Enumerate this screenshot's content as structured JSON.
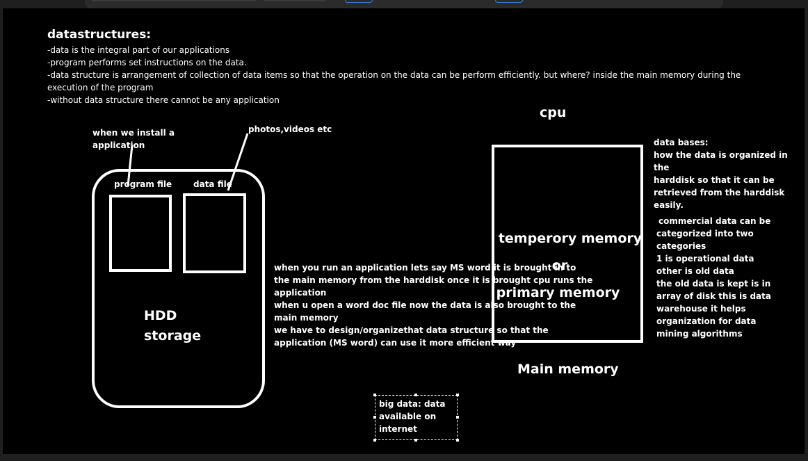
{
  "notes": {
    "heading": "datastructures:",
    "lines": [
      "-data is the integral part of our applications",
      "-program performs set instructions on the data.",
      "-data structure is arrangement of collection of data items so that the operation on the data can be perform efficiently. but where? inside the main memory during the",
      "execution of the program",
      "-without data structure there cannot be any application"
    ]
  },
  "hdd": {
    "install_note_1": "when we install a",
    "install_note_2": "application",
    "media_note": "photos,videos etc",
    "program_file": "program file",
    "data_file": "data file",
    "label_1": "HDD",
    "label_2": "storage"
  },
  "run_notes": [
    "when you run an application lets say MS word it is brought in to",
    "the main memory from the harddisk once it is brought cpu runs the",
    "application",
    "when u open a word doc file now the data is also brought to the",
    "main memory",
    "we have to design/organizethat data structure so that the",
    "application (MS word) can use it more efficient way"
  ],
  "memory": {
    "cpu": "cpu",
    "line_1": "temperory memory",
    "line_2": "or",
    "line_3": "primary memory",
    "caption": "Main memory"
  },
  "databases": [
    "data bases:",
    "how the data is organized in the",
    "harddisk so that it can be",
    "retrieved from the harddisk",
    "easily."
  ],
  "commercial": [
    "commercial data can be",
    "categorized into two",
    "categories",
    "1 is operational data",
    "other is old data",
    "the old data is kept is in",
    "array of disk this is data",
    "warehouse it helps",
    "organization for data",
    "mining algorithms"
  ],
  "bigdata": [
    "big data: data",
    "available on",
    "internet"
  ]
}
